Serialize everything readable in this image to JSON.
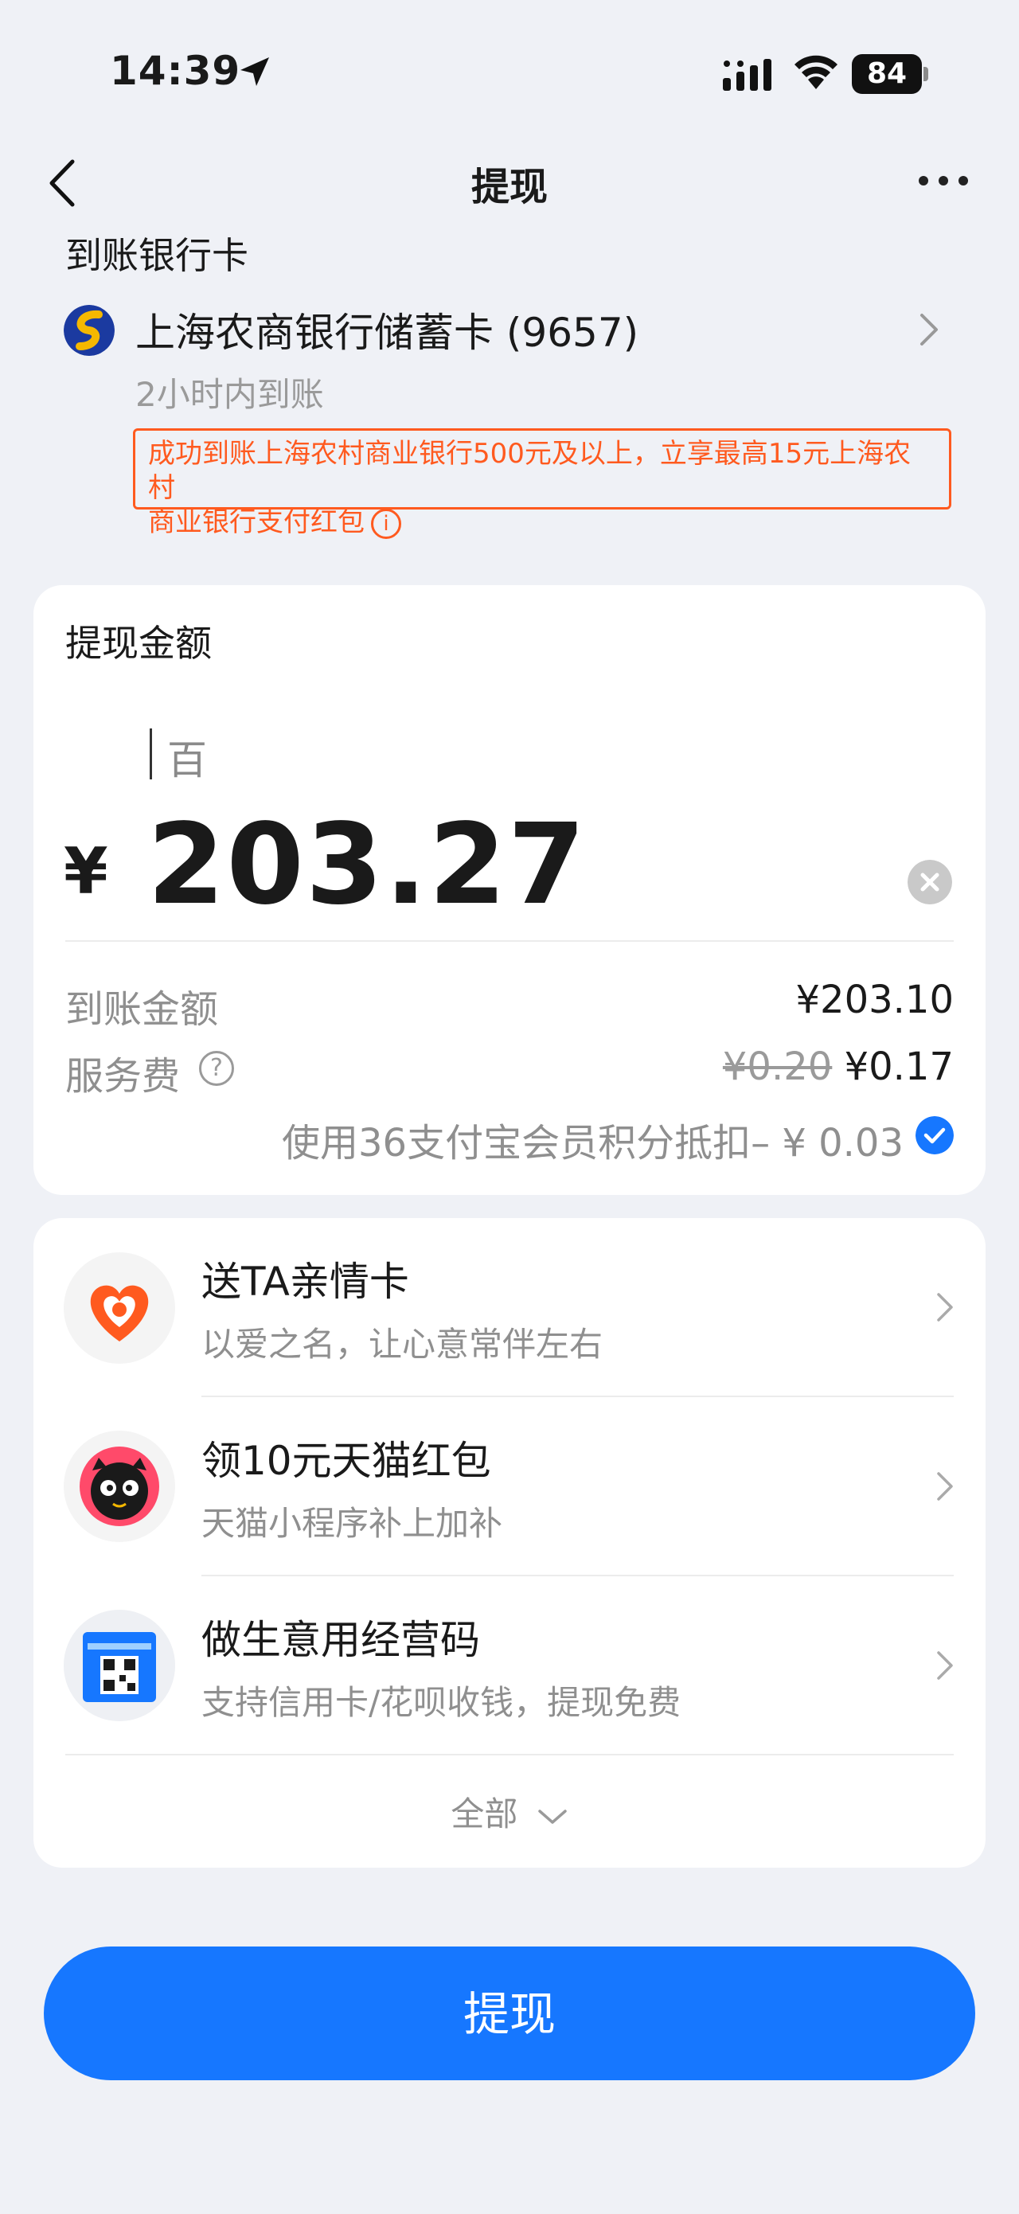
{
  "status_bar": {
    "time": "14:39",
    "battery": "84"
  },
  "nav": {
    "title": "提现",
    "back_icon": "chevron-left-icon",
    "more_icon": "more-horizontal-icon"
  },
  "bank_section": {
    "label": "到账银行卡",
    "bank_name": "上海农商银行储蓄卡 (9657)",
    "arrival_time": "2小时内到账",
    "promo_line1": "成功到账上海农村商业银行500元及以上，立享最高15元上海农村",
    "promo_line2": "商业银行支付红包",
    "promo_info_icon": "i"
  },
  "amount_card": {
    "label": "提现金额",
    "unit_hint": "百",
    "currency": "¥",
    "amount": "203.27",
    "arrival_label": "到账金额",
    "arrival_value": "¥203.10",
    "fee_label": "服务费",
    "fee_help_icon": "?",
    "fee_original": "¥0.20",
    "fee_value": "¥0.17",
    "points_text": "使用36支付宝会员积分抵扣– ¥ 0.03",
    "points_checked": true
  },
  "services": [
    {
      "title": "送TA亲情卡",
      "subtitle": "以爱之名，让心意常伴左右",
      "icon": "heart-card-icon"
    },
    {
      "title": "领10元天猫红包",
      "subtitle": "天猫小程序补上加补",
      "icon": "tmall-cat-icon"
    },
    {
      "title": "做生意用经营码",
      "subtitle": "支持信用卡/花呗收钱，提现免费",
      "icon": "qr-code-icon"
    }
  ],
  "expand_label": "全部",
  "withdraw_button": "提现",
  "colors": {
    "primary": "#1677ff",
    "promo": "#ff5a1f",
    "background": "#eff1f6"
  }
}
